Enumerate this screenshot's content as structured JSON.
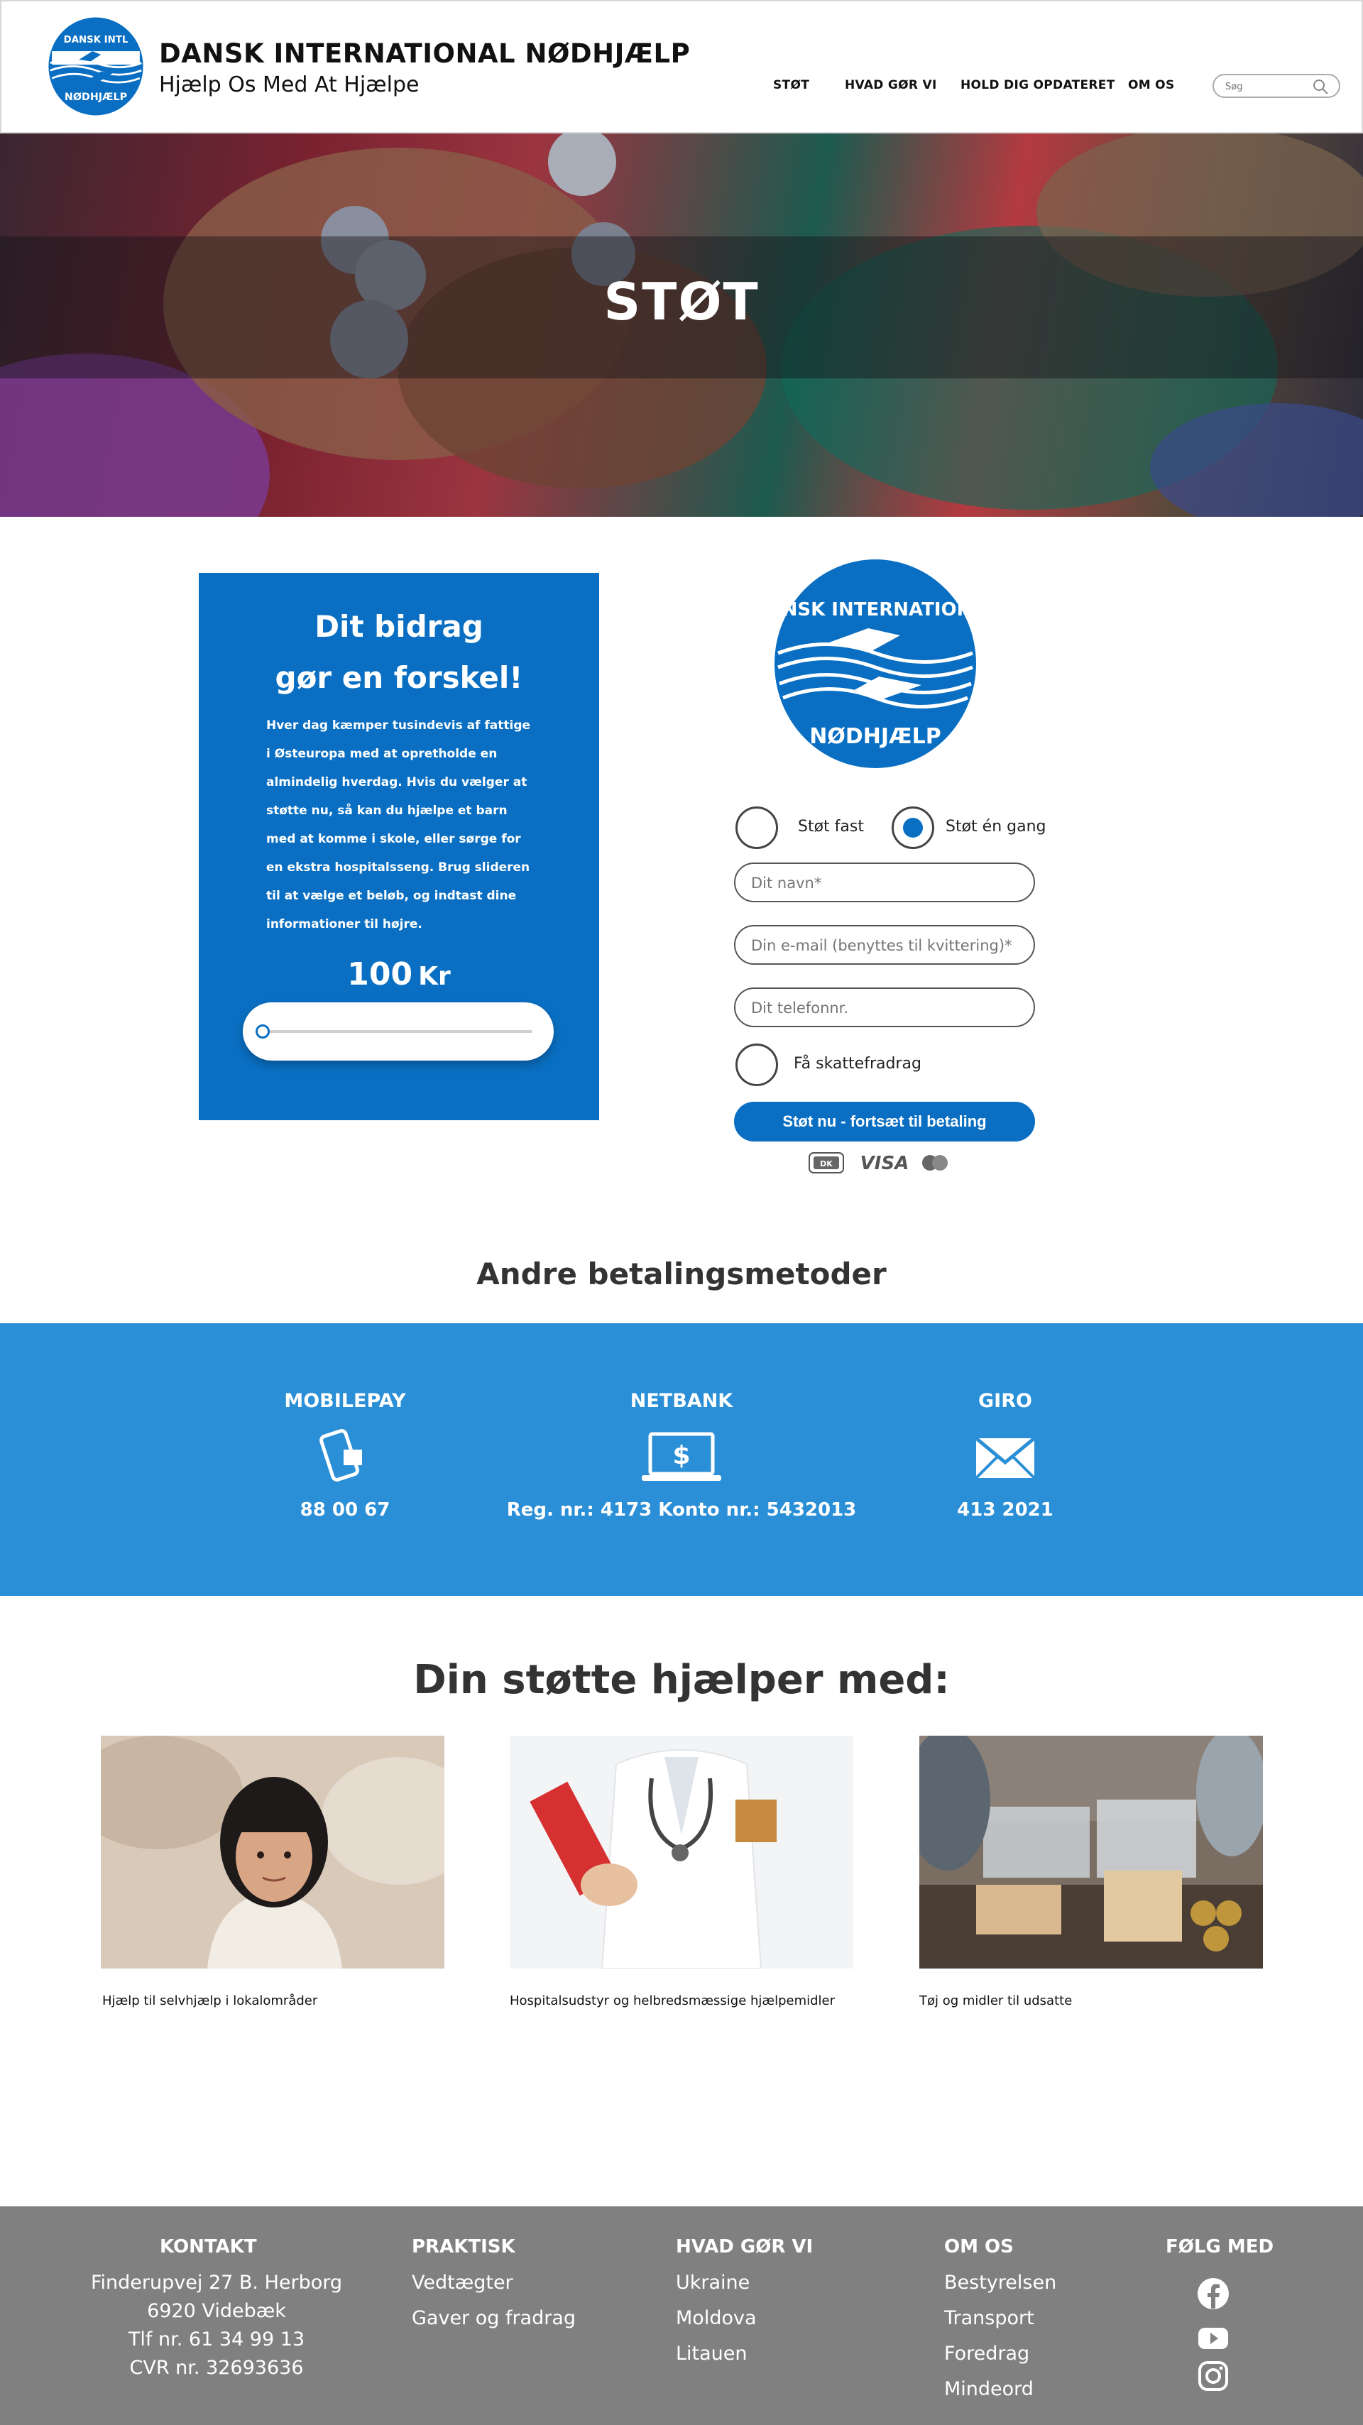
{
  "header": {
    "brand_title": "DANSK INTERNATIONAL NØDHJÆLP",
    "brand_subtitle": "Hjælp Os Med At Hjælpe",
    "nav": [
      "STØT",
      "HVAD GØR VI",
      "HOLD DIG OPDATERET",
      "OM OS"
    ],
    "search_placeholder": "Søg",
    "logo_text_top": "DANSK INTERNATIONAL",
    "logo_text_bottom": "NØDHJÆLP"
  },
  "hero": {
    "title": "STØT"
  },
  "donation": {
    "heading_line1": "Dit bidrag",
    "heading_line2": "gør en forskel!",
    "paragraph": "Hver dag kæmper tusindevis af fattige i Østeuropa med at opretholde en almindelig hverdag. Hvis du vælger at støtte nu, så kan du hjælpe et barn med at komme i skole, eller sørge for en ekstra hospitalsseng. Brug slideren til at vælge et beløb, og indtast dine informationer til højre.",
    "amount": "100",
    "currency": "Kr",
    "slider_level": 0
  },
  "form": {
    "option_fixed": "Støt fast",
    "option_once": "Støt én gang",
    "selected_option": "once",
    "name_placeholder": "Dit navn*",
    "email_placeholder": "Din e-mail (benyttes til kvittering)*",
    "phone_placeholder": "Dit telefonnr.",
    "tax_label": "Få skattefradrag",
    "submit_label": "Støt nu - fortsæt til betaling",
    "card_logos": [
      "DK",
      "VISA",
      "mastercard"
    ]
  },
  "other_methods": {
    "title": "Andre betalingsmetoder",
    "methods": [
      {
        "name": "MOBILEPAY",
        "value": "88 00 67",
        "icon": "phone-icon"
      },
      {
        "name": "NETBANK",
        "value": "Reg. nr.: 4173 Konto nr.: 5432013",
        "icon": "laptop-dollar-icon"
      },
      {
        "name": "GIRO",
        "value": "413 2021",
        "icon": "envelope-icon"
      }
    ]
  },
  "support": {
    "title": "Din støtte hjælper med:",
    "items": [
      {
        "caption": "Hjælp til selvhjælp i lokalområder"
      },
      {
        "caption": "Hospitalsudstyr og helbredsmæssige hjælpemidler"
      },
      {
        "caption": "Tøj og midler til udsatte"
      }
    ]
  },
  "footer": {
    "kontakt": {
      "heading": "KONTAKT",
      "lines": [
        "Finderupvej 27 B. Herborg",
        "6920 Videbæk",
        "Tlf nr. 61 34 99 13",
        "CVR nr. 32693636"
      ]
    },
    "praktisk": {
      "heading": "PRAKTISK",
      "links": [
        "Vedtægter",
        "Gaver og fradrag"
      ]
    },
    "hvad": {
      "heading": "HVAD GØR VI",
      "links": [
        "Ukraine",
        "Moldova",
        "Litauen"
      ]
    },
    "omos": {
      "heading": "OM OS",
      "links": [
        "Bestyrelsen",
        "Transport",
        "Foredrag",
        "Mindeord"
      ]
    },
    "folg": {
      "heading": "FØLG MED"
    }
  },
  "colors": {
    "brand_blue": "#0a6fc2",
    "methods_blue": "#2a8fd6",
    "footer_gray": "#808080"
  }
}
